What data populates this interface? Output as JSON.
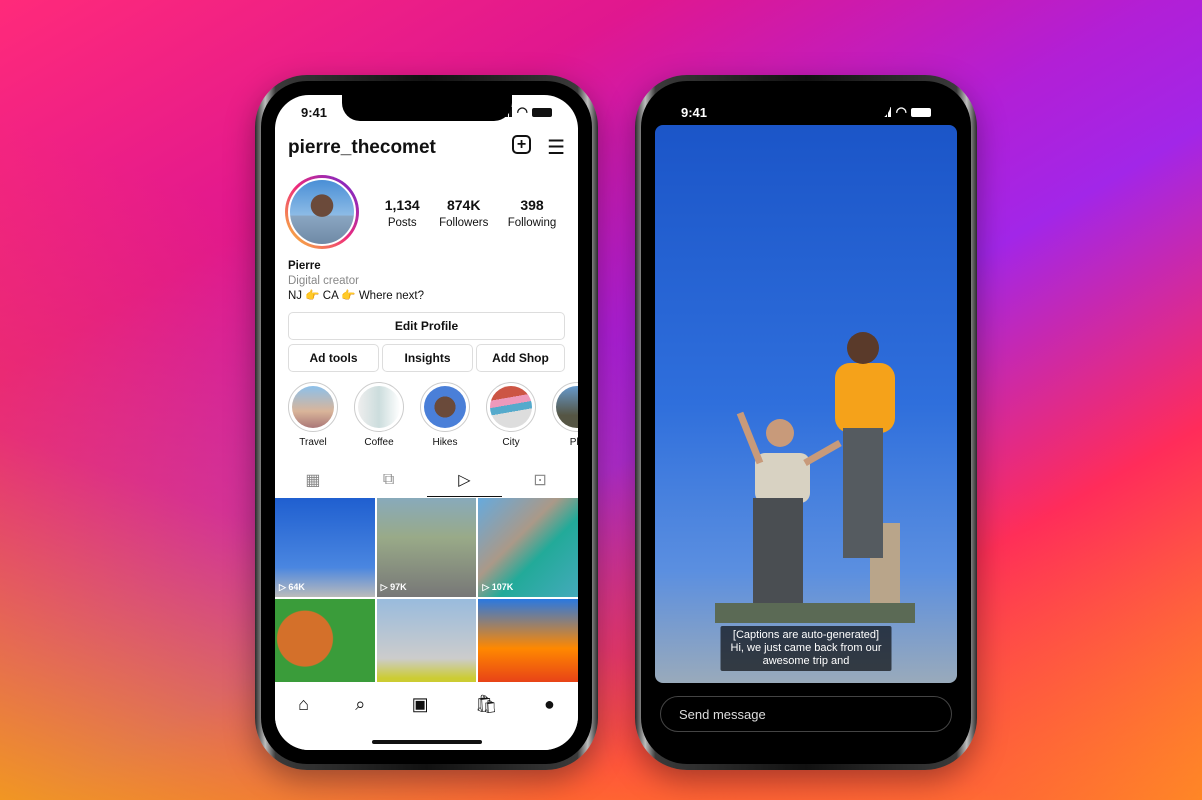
{
  "left_phone": {
    "time": "9:41",
    "username": "pierre_thecomet",
    "stats": [
      {
        "value": "1,134",
        "label": "Posts"
      },
      {
        "value": "874K",
        "label": "Followers"
      },
      {
        "value": "398",
        "label": "Following"
      }
    ],
    "bio": {
      "name": "Pierre",
      "category": "Digital creator",
      "text": "NJ 👉 CA 👉 Where next?"
    },
    "buttons": {
      "edit_profile": "Edit Profile",
      "ad_tools": "Ad tools",
      "insights": "Insights",
      "add_shop": "Add Shop"
    },
    "highlights": [
      "Travel",
      "Coffee",
      "Hikes",
      "City",
      "Pla"
    ],
    "reels": [
      "64K",
      "97K",
      "107K",
      "",
      "",
      ""
    ],
    "active_tab": "reels"
  },
  "right_phone": {
    "time": "9:41",
    "caption": [
      "[Captions are auto-generated]",
      "Hi, we just came back from our",
      "awesome trip and"
    ],
    "message_placeholder": "Send message"
  }
}
